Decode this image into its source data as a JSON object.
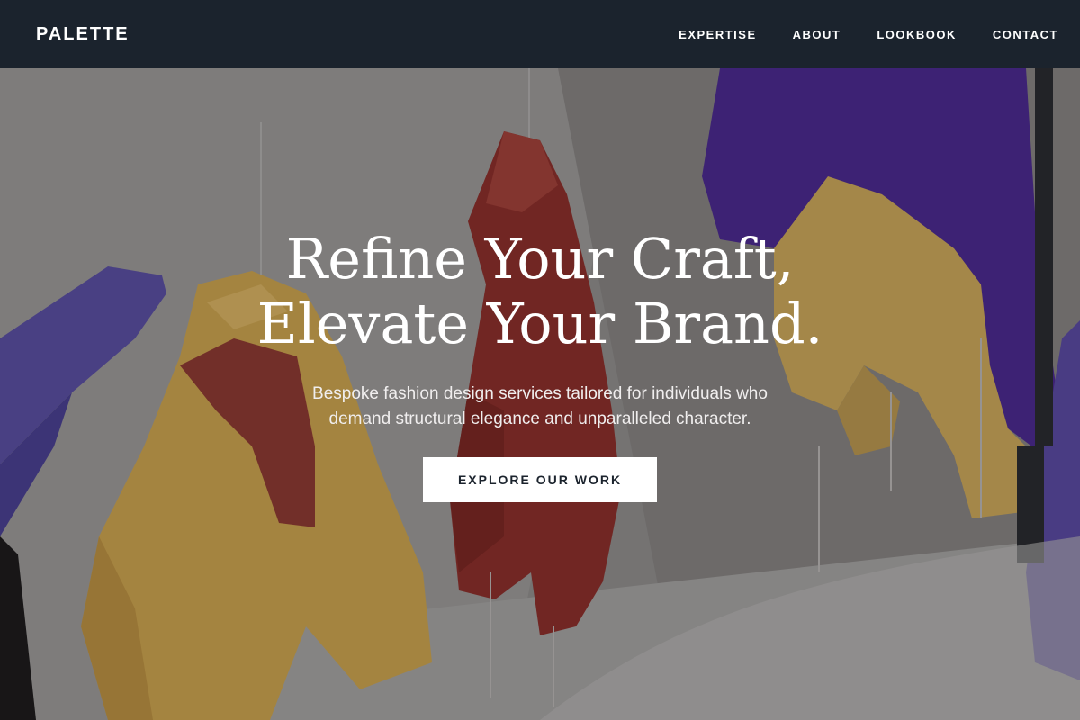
{
  "brand": {
    "logo": "PALETTE"
  },
  "nav": {
    "items": [
      {
        "label": "EXPERTISE"
      },
      {
        "label": "ABOUT"
      },
      {
        "label": "LOOKBOOK"
      },
      {
        "label": "CONTACT"
      }
    ]
  },
  "hero": {
    "headline_line1": "Refine Your Craft,",
    "headline_line2": "Elevate Your Brand.",
    "subtitle_line1": "Bespoke fashion design services tailored for individuals who",
    "subtitle_line2": "demand structural elegance and unparalleled character.",
    "cta_label": "EXPLORE OUR WORK",
    "background_image": "hanging jackets in purple, yellow and red nylon on a gallery floor"
  },
  "colors": {
    "navbar": "#1b232d",
    "cta_bg": "#ffffff",
    "cta_text": "#1b232d",
    "text": "#ffffff"
  }
}
